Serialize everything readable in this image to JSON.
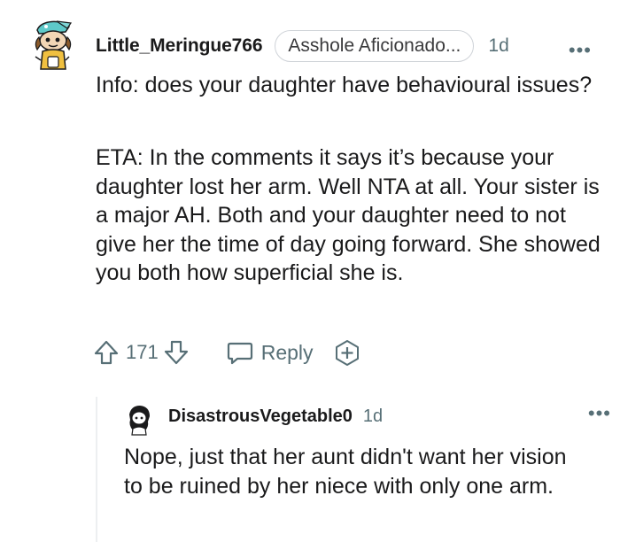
{
  "comment": {
    "username": "Little_Meringue766",
    "flair": "Asshole Aficionado...",
    "time": "1d",
    "more": "•••",
    "paragraphs": [
      "Info: does your daughter have behavioural issues?",
      "ETA: In the comments it says it’s because your daughter lost her arm. Well NTA at all. Your sister is a major AH. Both and your daughter need to not give her the time of day going forward. She showed you both how superficial she is."
    ],
    "votes": "171",
    "reply_label": "Reply",
    "icons": {
      "upvote": "arrow-up-icon",
      "downvote": "arrow-down-icon",
      "reply": "speech-bubble-icon",
      "award": "award-plus-icon"
    }
  },
  "reply": {
    "username": "DisastrousVegetable0",
    "time": "1d",
    "more": "•••",
    "text": "Nope, just that her aunt didn't want her vision to be ruined by her niece with only one arm."
  },
  "colors": {
    "text": "#1a1a1b",
    "muted": "#576f76",
    "border": "#cfd3d8",
    "thread_line": "#edeff1"
  }
}
